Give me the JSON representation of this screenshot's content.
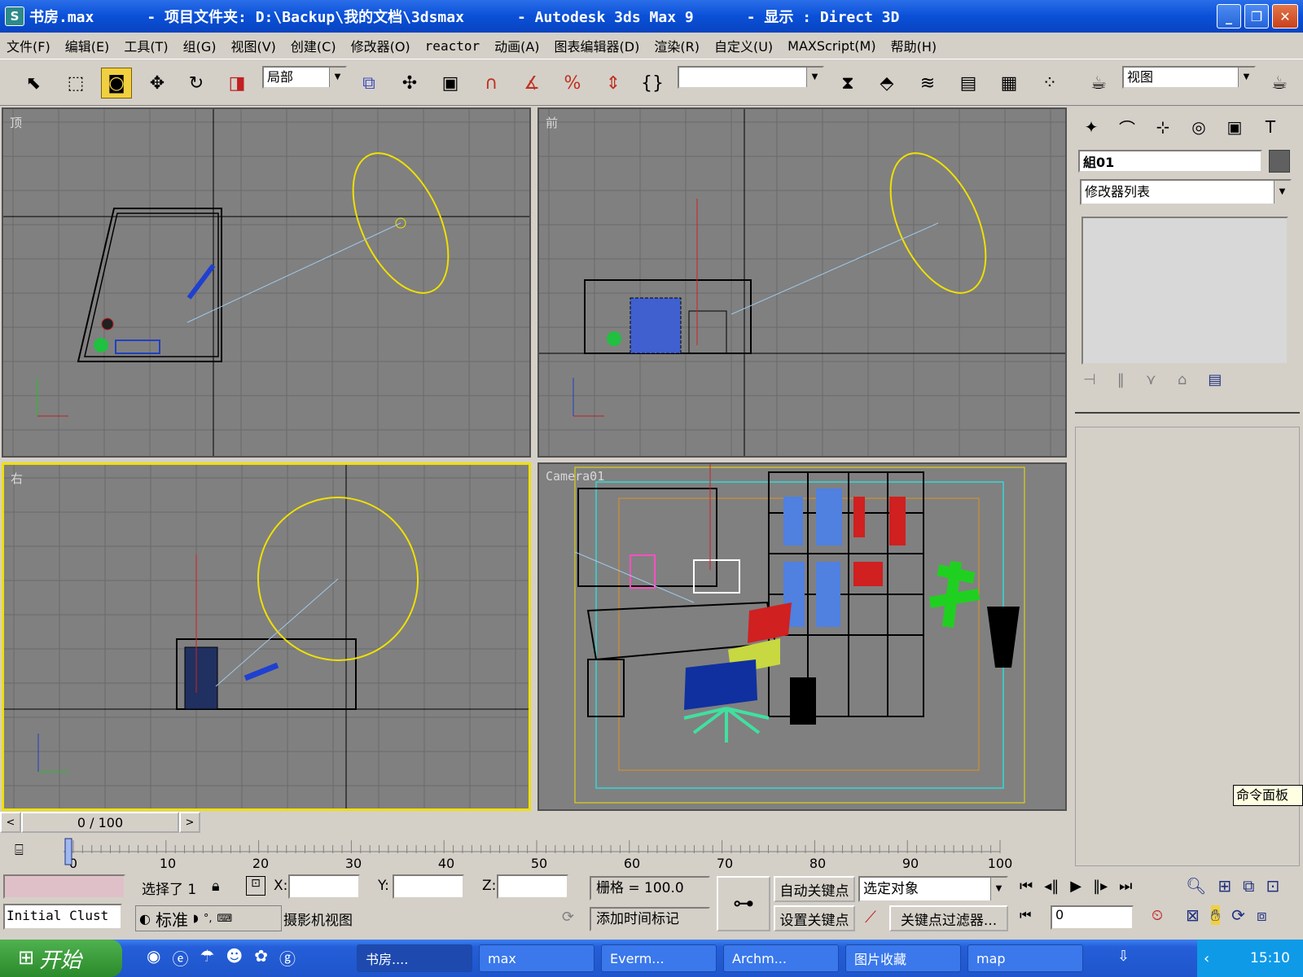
{
  "title": {
    "icon": "S",
    "text": "书房.max      - 项目文件夹: D:\\Backup\\我的文档\\3dsmax      - Autodesk 3ds Max 9      - 显示 : Direct 3D"
  },
  "window_buttons": {
    "minimize": "_",
    "maximize": "❐",
    "close": "✕"
  },
  "menu": [
    "文件(F)",
    "编辑(E)",
    "工具(T)",
    "组(G)",
    "视图(V)",
    "创建(C)",
    "修改器(O)",
    "reactor",
    "动画(A)",
    "图表编辑器(D)",
    "渲染(R)",
    "自定义(U)",
    "MAXScript(M)",
    "帮助(H)"
  ],
  "toolbar": {
    "coord_system": "局部",
    "named_selection": "",
    "view_dropdown": "视图"
  },
  "viewports": {
    "top": "顶",
    "front": "前",
    "right": "右",
    "camera": "Camera01"
  },
  "cmdpanel": {
    "object_name": "組01",
    "modifier_list": "修改器列表",
    "tooltip": "命令面板"
  },
  "timeline": {
    "frame": "0 / 100",
    "ticks": [
      "0",
      "10",
      "20",
      "30",
      "40",
      "50",
      "60",
      "70",
      "80",
      "90",
      "100"
    ]
  },
  "status": {
    "selected": "选择了 1",
    "x_label": "X:",
    "y_label": "Y:",
    "z_label": "Z:",
    "grid": "栅格 = 100.0",
    "auto_key": "自动关键点",
    "selected_object": "选定对象",
    "set_key": "设置关键点",
    "key_filter": "关键点过滤器...",
    "add_time_tag": "添加时间标记",
    "frame_value": "0",
    "prompt": "摄影机视图",
    "maxscript_listener": "Initial Clust",
    "ime_mode": "标准"
  },
  "taskbar": {
    "start": "开始",
    "tasks": [
      "书房....",
      "max",
      "Everm...",
      "Archm...",
      "图片收藏",
      "map"
    ],
    "clock": "15:10"
  },
  "colors": {
    "selection_yellow": "#f0e000",
    "viewport_gray": "#808080",
    "titlebar_blue": "#0a50d8",
    "start_green": "#2b8a2b"
  }
}
